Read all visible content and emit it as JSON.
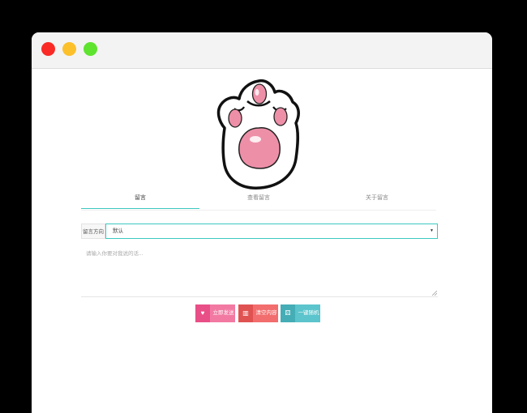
{
  "window": {
    "controls": [
      "close-button",
      "minimize-button",
      "maximize-button"
    ],
    "colors": {
      "close": "#fa2a26",
      "minimize": "#fcc02b",
      "maximize": "#5ee32f"
    }
  },
  "logo": {
    "icon": "cat-paw-icon"
  },
  "tabs": [
    {
      "label": "留言",
      "active": true
    },
    {
      "label": "查看留言",
      "active": false
    },
    {
      "label": "关于留言",
      "active": false
    }
  ],
  "form": {
    "direction_label": "留言方向",
    "direction_value": "默认",
    "message_placeholder": "请输入你要对我说的话..."
  },
  "buttons": [
    {
      "label": "立即发送",
      "icon": "heart-icon",
      "color": "#f27aa2"
    },
    {
      "label": "清空内容",
      "icon": "trash-icon",
      "color": "#f26d6d"
    },
    {
      "label": "一键随机",
      "icon": "dice-icon",
      "color": "#5bc4cc"
    }
  ],
  "accent_color": "#3ec8c0"
}
